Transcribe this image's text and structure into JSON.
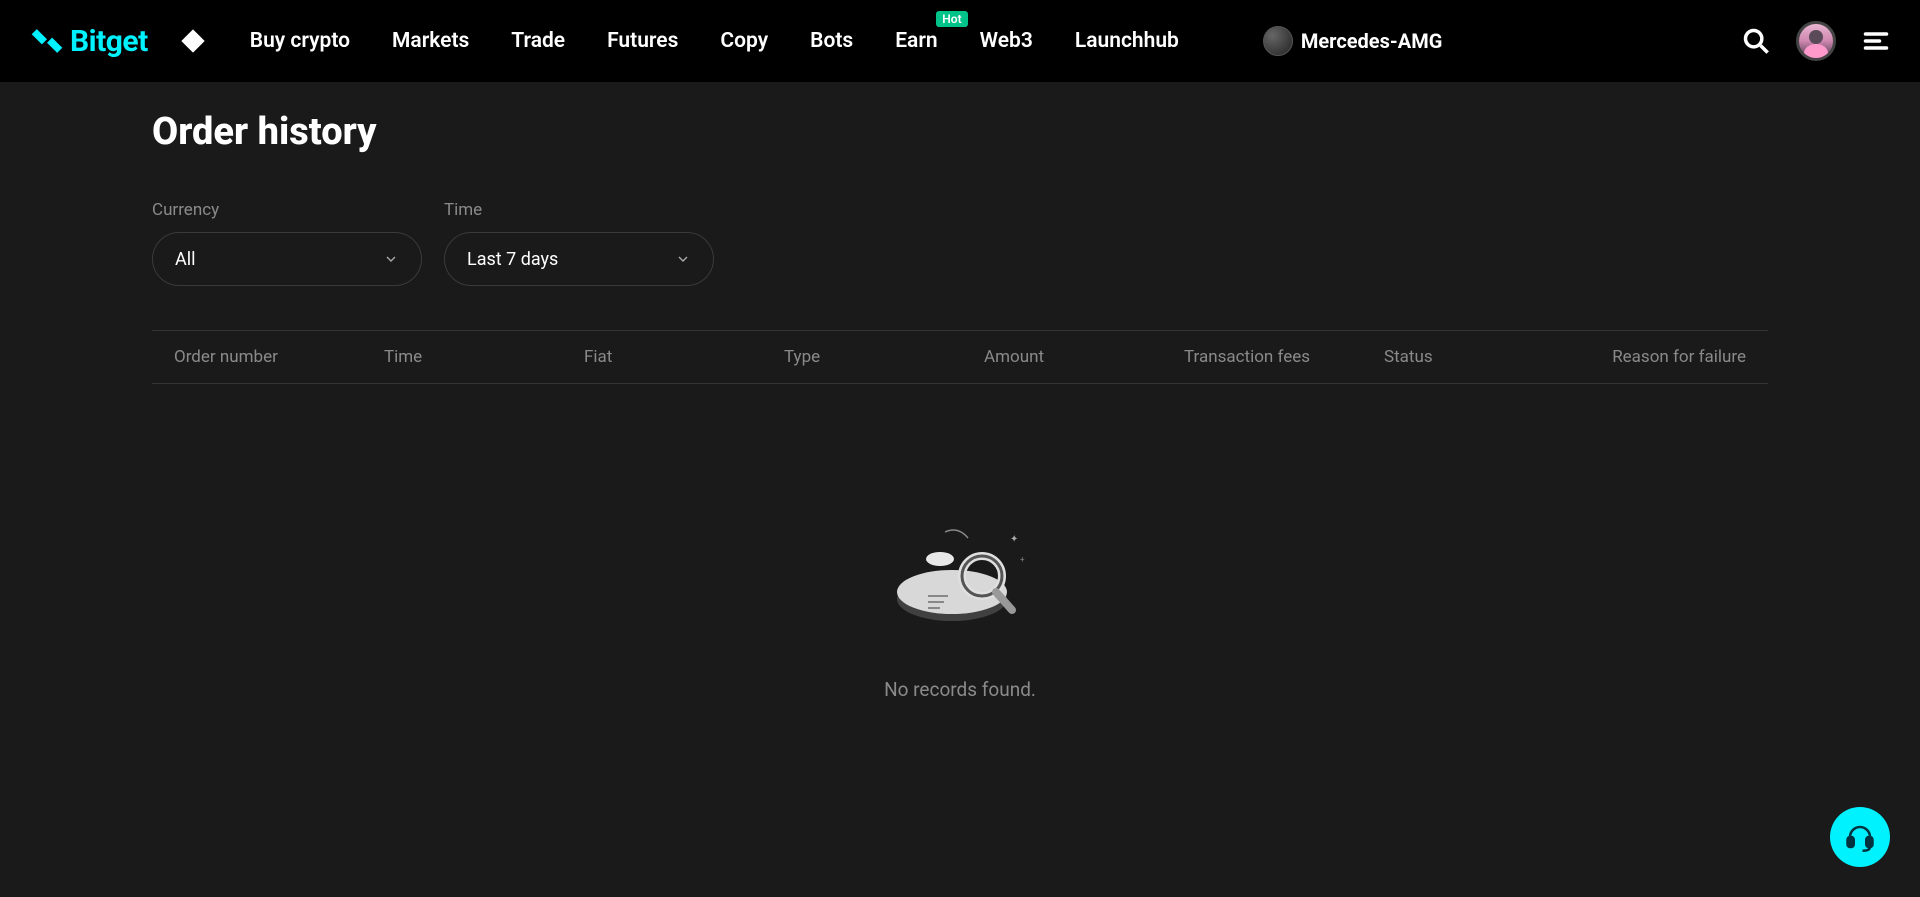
{
  "brand": "Bitget",
  "nav": {
    "items": [
      "Buy crypto",
      "Markets",
      "Trade",
      "Futures",
      "Copy",
      "Bots",
      "Earn",
      "Web3",
      "Launchhub"
    ],
    "hot_badge": "Hot",
    "hot_index": 6
  },
  "partner": {
    "name": "Mercedes-AMG"
  },
  "page": {
    "title": "Order history"
  },
  "filters": {
    "currency": {
      "label": "Currency",
      "value": "All"
    },
    "time": {
      "label": "Time",
      "value": "Last 7 days"
    }
  },
  "table": {
    "columns": [
      "Order number",
      "Time",
      "Fiat",
      "Type",
      "Amount",
      "Transaction fees",
      "Status",
      "Reason for failure"
    ]
  },
  "empty_state": {
    "text": "No records found."
  },
  "colors": {
    "accent": "#00f2ff",
    "badge": "#00c389"
  }
}
